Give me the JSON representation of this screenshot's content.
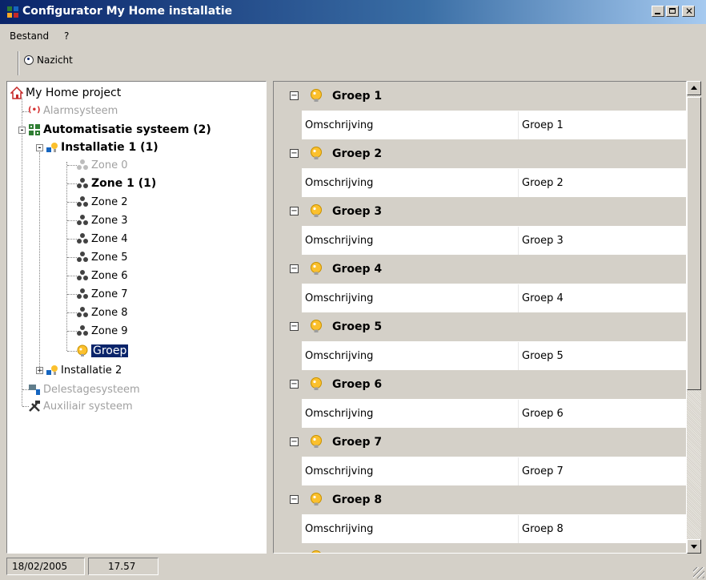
{
  "window": {
    "title": "Configurator My Home installatie"
  },
  "menu": {
    "items": [
      "Bestand",
      "?"
    ]
  },
  "toolbar": {
    "nazicht_label": "Nazicht"
  },
  "tree": {
    "items": [
      {
        "label": "My Home project",
        "icon": "house-icon",
        "style": "normal"
      },
      {
        "label": "Alarmsysteem",
        "icon": "alarm-icon",
        "style": "dim"
      },
      {
        "label": "Automatisatie systeem (2)",
        "icon": "automation-icon",
        "style": "bold",
        "expander": "-"
      },
      {
        "label": "Installatie 1 (1)",
        "icon": "installation-icon",
        "style": "bold",
        "expander": "-"
      },
      {
        "label": "Zone 0",
        "icon": "zone-icon",
        "style": "dim"
      },
      {
        "label": "Zone 1 (1)",
        "icon": "zone-icon",
        "style": "bold"
      },
      {
        "label": "Zone 2",
        "icon": "zone-icon",
        "style": "normal"
      },
      {
        "label": "Zone 3",
        "icon": "zone-icon",
        "style": "normal"
      },
      {
        "label": "Zone 4",
        "icon": "zone-icon",
        "style": "normal"
      },
      {
        "label": "Zone 5",
        "icon": "zone-icon",
        "style": "normal"
      },
      {
        "label": "Zone 6",
        "icon": "zone-icon",
        "style": "normal"
      },
      {
        "label": "Zone 7",
        "icon": "zone-icon",
        "style": "normal"
      },
      {
        "label": "Zone 8",
        "icon": "zone-icon",
        "style": "normal"
      },
      {
        "label": "Zone 9",
        "icon": "zone-icon",
        "style": "normal"
      },
      {
        "label": "Groep",
        "icon": "group-icon",
        "style": "selected"
      },
      {
        "label": "Installatie 2",
        "icon": "installation-icon",
        "style": "normal",
        "expander": "+"
      },
      {
        "label": "Delestagesysteem",
        "icon": "load-shedding-icon",
        "style": "dim"
      },
      {
        "label": "Auxiliair systeem",
        "icon": "tools-icon",
        "style": "dim"
      }
    ]
  },
  "groups": [
    {
      "title": "Groep 1",
      "field": "Omschrijving",
      "value": "Groep 1"
    },
    {
      "title": "Groep 2",
      "field": "Omschrijving",
      "value": "Groep 2"
    },
    {
      "title": "Groep 3",
      "field": "Omschrijving",
      "value": "Groep 3"
    },
    {
      "title": "Groep 4",
      "field": "Omschrijving",
      "value": "Groep 4"
    },
    {
      "title": "Groep 5",
      "field": "Omschrijving",
      "value": "Groep 5"
    },
    {
      "title": "Groep 6",
      "field": "Omschrijving",
      "value": "Groep 6"
    },
    {
      "title": "Groep 7",
      "field": "Omschrijving",
      "value": "Groep 7"
    },
    {
      "title": "Groep 8",
      "field": "Omschrijving",
      "value": "Groep 8"
    }
  ],
  "status": {
    "date": "18/02/2005",
    "time": "17.57"
  },
  "colors": {
    "title_start": "#0a246a",
    "title_end": "#a6caf0",
    "selection": "#0a246a",
    "dim_text": "#a0a0a0"
  }
}
